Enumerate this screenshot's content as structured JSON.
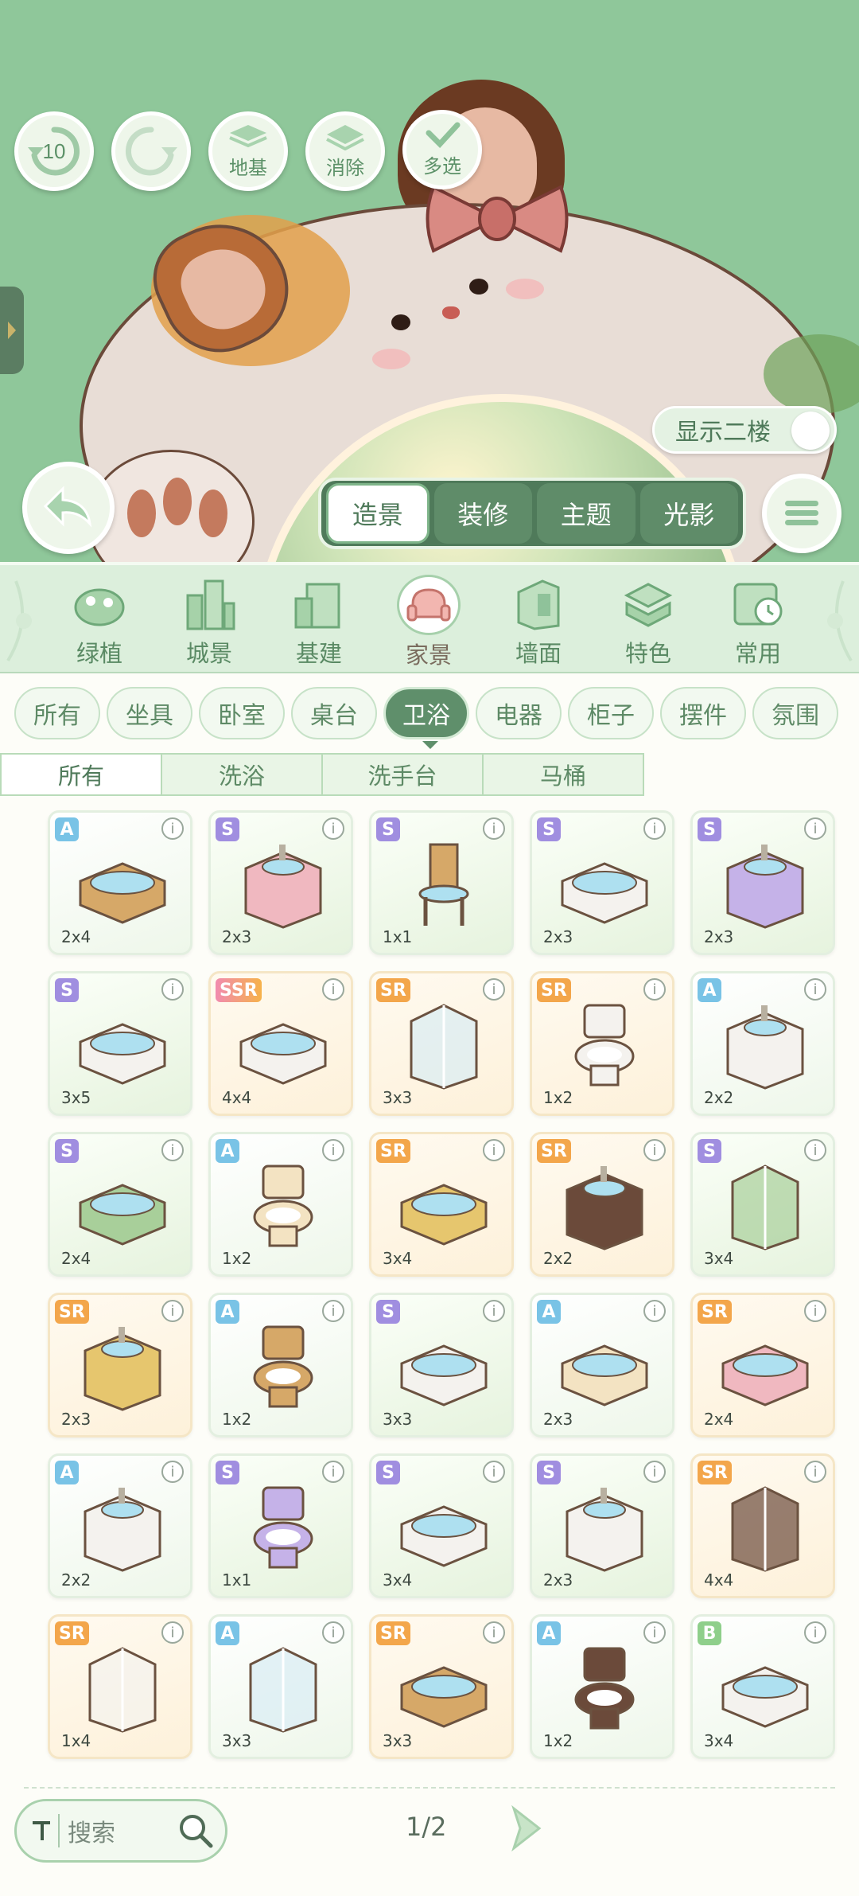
{
  "toolbar": {
    "undo_count": "10",
    "foundation_label": "地基",
    "erase_label": "消除",
    "multiselect_label": "多选"
  },
  "floor_toggle_label": "显示二楼",
  "modes": [
    "造景",
    "装修",
    "主题",
    "光影"
  ],
  "categories": [
    "绿植",
    "城景",
    "基建",
    "家景",
    "墙面",
    "特色",
    "常用"
  ],
  "filters": [
    "所有",
    "坐具",
    "卧室",
    "桌台",
    "卫浴",
    "电器",
    "柜子",
    "摆件",
    "氛围"
  ],
  "subtabs": [
    "所有",
    "洗浴",
    "洗手台",
    "马桶"
  ],
  "items": [
    {
      "rarity": "A",
      "size": "2x4",
      "kind": "bathtub-wood"
    },
    {
      "rarity": "S",
      "size": "2x3",
      "kind": "vanity-pink"
    },
    {
      "rarity": "S",
      "size": "1x1",
      "kind": "chair-basin"
    },
    {
      "rarity": "S",
      "size": "2x3",
      "kind": "clawfoot-tub"
    },
    {
      "rarity": "S",
      "size": "2x3",
      "kind": "vanity-purple"
    },
    {
      "rarity": "S",
      "size": "3x5",
      "kind": "guitar-tub"
    },
    {
      "rarity": "SSR",
      "size": "4x4",
      "kind": "step-tub"
    },
    {
      "rarity": "SR",
      "size": "3x3",
      "kind": "shower-glass"
    },
    {
      "rarity": "SR",
      "size": "1x2",
      "kind": "toilet-white"
    },
    {
      "rarity": "A",
      "size": "2x2",
      "kind": "sink-cabinet"
    },
    {
      "rarity": "S",
      "size": "2x4",
      "kind": "leaf-tub"
    },
    {
      "rarity": "A",
      "size": "1x2",
      "kind": "toilet-cream"
    },
    {
      "rarity": "SR",
      "size": "3x4",
      "kind": "gold-tub"
    },
    {
      "rarity": "SR",
      "size": "2x2",
      "kind": "sink-dark"
    },
    {
      "rarity": "S",
      "size": "3x4",
      "kind": "greenhouse-shower"
    },
    {
      "rarity": "SR",
      "size": "2x3",
      "kind": "mirror-vanity"
    },
    {
      "rarity": "A",
      "size": "1x2",
      "kind": "toilet-wood"
    },
    {
      "rarity": "S",
      "size": "3x3",
      "kind": "round-tub"
    },
    {
      "rarity": "A",
      "size": "2x3",
      "kind": "clawfoot-cream"
    },
    {
      "rarity": "SR",
      "size": "2x4",
      "kind": "flower-tub"
    },
    {
      "rarity": "A",
      "size": "2x2",
      "kind": "sink-shelf"
    },
    {
      "rarity": "S",
      "size": "1x1",
      "kind": "toilet-purple"
    },
    {
      "rarity": "S",
      "size": "3x4",
      "kind": "tub-white"
    },
    {
      "rarity": "S",
      "size": "2x3",
      "kind": "double-sink"
    },
    {
      "rarity": "SR",
      "size": "4x4",
      "kind": "shower-bronze"
    },
    {
      "rarity": "SR",
      "size": "1x4",
      "kind": "shower-pipe"
    },
    {
      "rarity": "A",
      "size": "3x3",
      "kind": "shower-blue"
    },
    {
      "rarity": "SR",
      "size": "3x3",
      "kind": "barrel-tub"
    },
    {
      "rarity": "A",
      "size": "1x2",
      "kind": "toilet-brown"
    },
    {
      "rarity": "B",
      "size": "3x4",
      "kind": "pool-tub"
    }
  ],
  "search": {
    "placeholder": "搜索"
  },
  "pagination": {
    "current": 1,
    "total": 2,
    "label": "1/2"
  },
  "colors": {
    "primary": "#5f8f6b",
    "scene_bg": "#8fc79a",
    "chip_bg": "#f2f9f0"
  }
}
